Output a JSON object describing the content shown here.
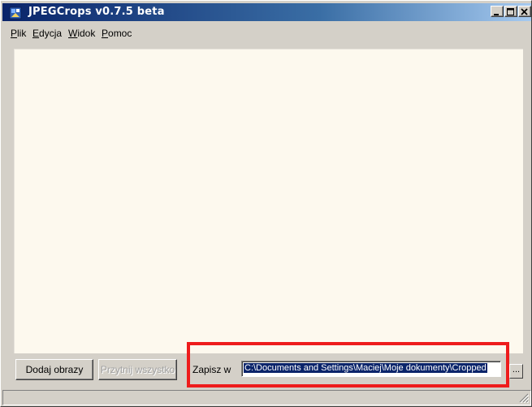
{
  "window": {
    "title": "JPEGCrops v0.7.5 beta",
    "icon": "jpegcrops-app-icon",
    "controls": [
      "minimize-icon",
      "maximize-icon",
      "close-icon"
    ]
  },
  "menu": {
    "items": [
      {
        "label": "Plik",
        "accel": "P",
        "rest": "lik"
      },
      {
        "label": "Edycja",
        "accel": "E",
        "rest": "dycja"
      },
      {
        "label": "Widok",
        "accel": "W",
        "rest": "idok"
      },
      {
        "label": "Pomoc",
        "accel": "P",
        "rest": "omoc"
      }
    ]
  },
  "buttons": {
    "add_images": "Dodaj obrazy",
    "crop_all": "Przytnij wszystko",
    "browse": "..."
  },
  "save": {
    "label": "Zapisz w",
    "path": "C:\\Documents and Settings\\Maciej\\Moje dokumenty\\Cropped"
  },
  "colors": {
    "canvas": "#fdf9ee",
    "highlight": "#ee1c1c",
    "selection": "#0a246a"
  }
}
